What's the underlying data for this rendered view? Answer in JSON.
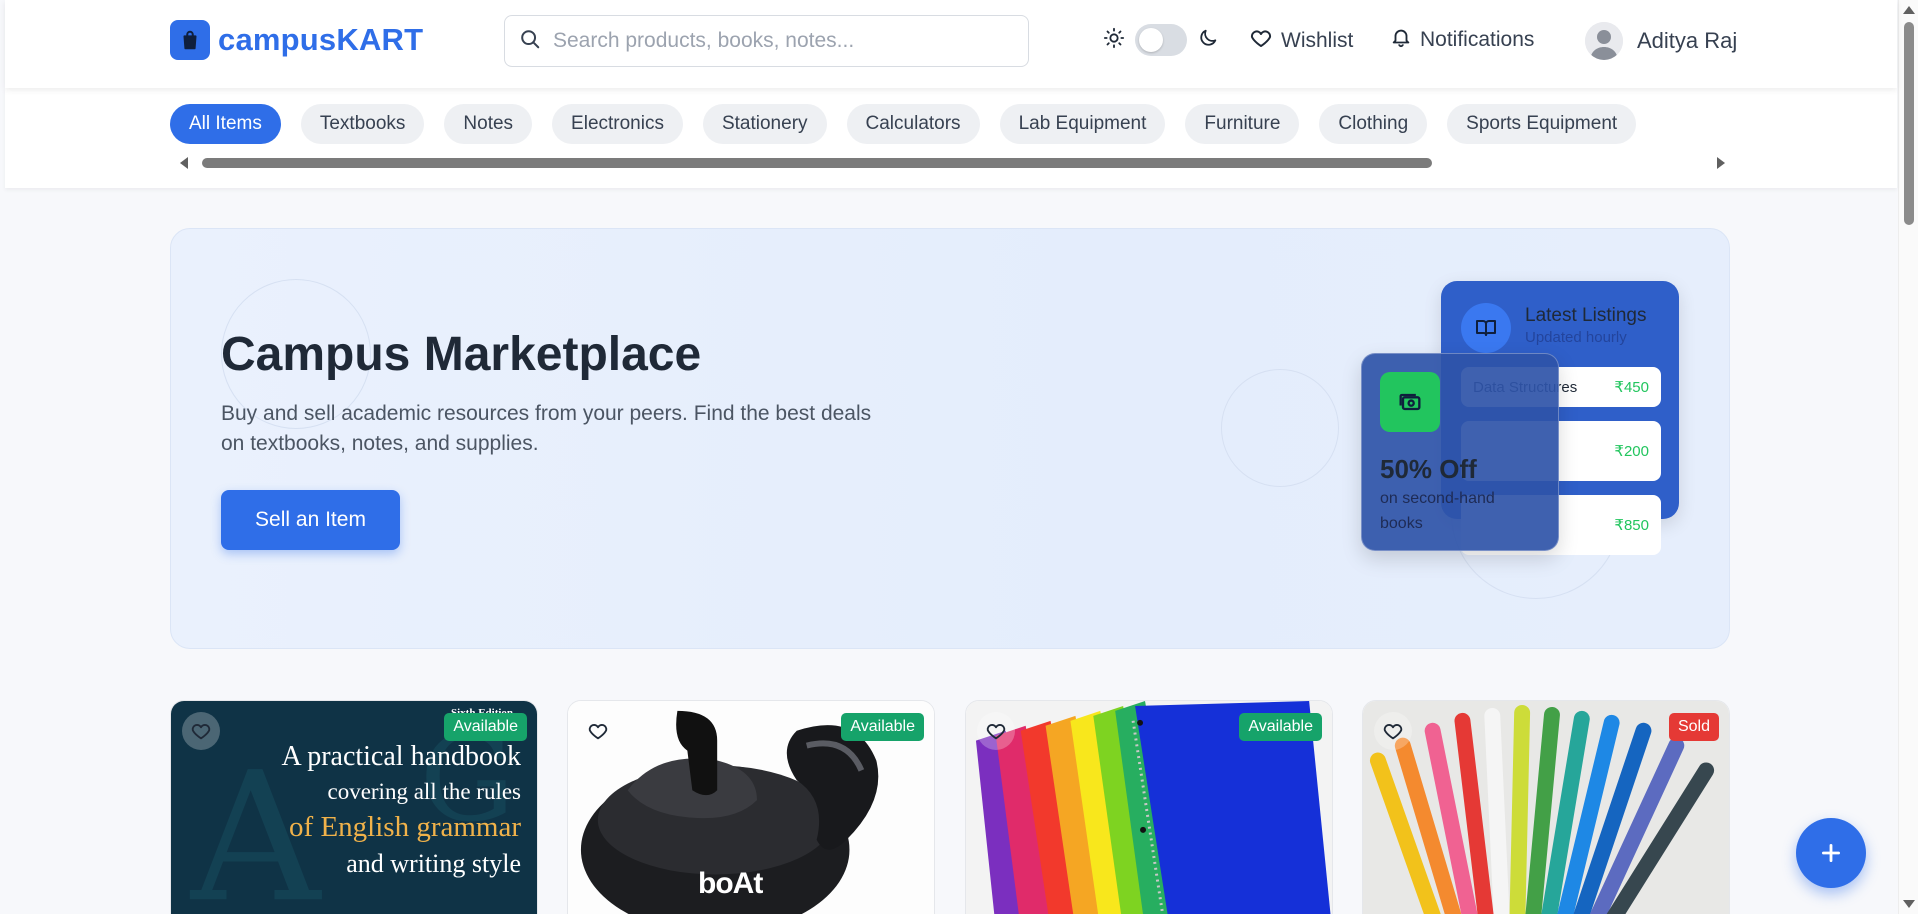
{
  "header": {
    "logo_prefix": "campus",
    "logo_suffix": "KART",
    "search": {
      "placeholder": "Search products, books, notes..."
    },
    "wishlist_label": "Wishlist",
    "notifications_label": "Notifications",
    "user_name": "Aditya Raj"
  },
  "categories": [
    {
      "label": "All Items",
      "active": true
    },
    {
      "label": "Textbooks"
    },
    {
      "label": "Notes"
    },
    {
      "label": "Electronics"
    },
    {
      "label": "Stationery"
    },
    {
      "label": "Calculators"
    },
    {
      "label": "Lab Equipment"
    },
    {
      "label": "Furniture"
    },
    {
      "label": "Clothing"
    },
    {
      "label": "Sports Equipment"
    }
  ],
  "hero": {
    "title": "Campus Marketplace",
    "subtitle": "Buy and sell academic resources from your peers. Find the best deals on textbooks, notes, and supplies.",
    "cta": "Sell an Item",
    "latest": {
      "title": "Latest Listings",
      "subtitle": "Updated hourly",
      "items": [
        {
          "name": "Data Structures",
          "price": "₹450"
        },
        {
          "name": "",
          "price": "₹200"
        },
        {
          "name": "",
          "price": "₹850"
        }
      ]
    },
    "offer": {
      "headline": "50% Off",
      "text": "on second-hand books"
    }
  },
  "products": [
    {
      "status": "Available",
      "cover_edition": "Sixth Edition",
      "cover_lines": [
        "A practical handbook",
        "covering all the rules",
        "of English grammar",
        "and writing style"
      ]
    },
    {
      "status": "Available",
      "brand": "boAt"
    },
    {
      "status": "Available"
    },
    {
      "status": "Sold"
    }
  ],
  "colors": {
    "accent": "#2f6ee8",
    "available": "#16a36a",
    "sold": "#e53935",
    "price": "#22c55e"
  }
}
